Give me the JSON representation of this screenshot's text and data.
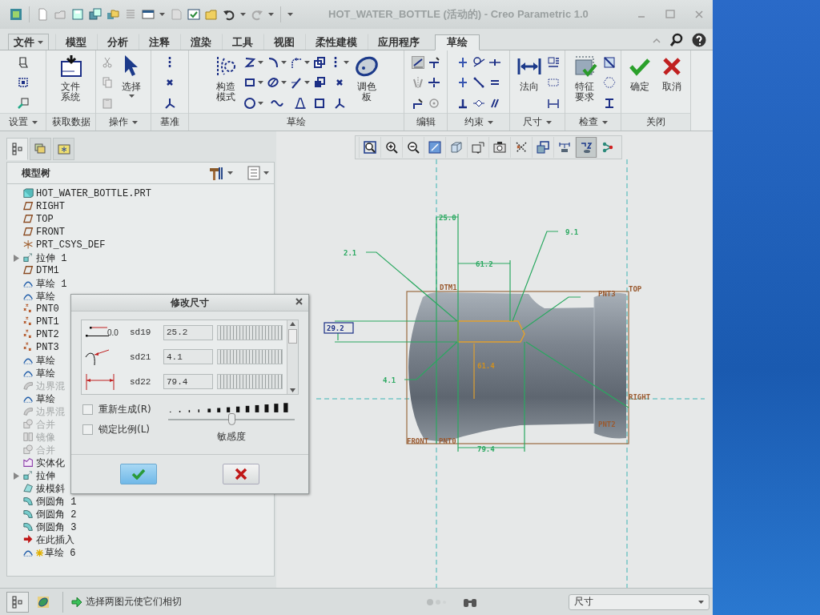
{
  "window": {
    "title": "HOT_WATER_BOTTLE (活动的) - Creo Parametric 1.0"
  },
  "ribbon_tabs": [
    {
      "label": "文件",
      "kind": "menu",
      "selected": false
    },
    {
      "label": "模型",
      "kind": "tab",
      "selected": false
    },
    {
      "label": "分析",
      "kind": "tab",
      "selected": false
    },
    {
      "label": "注释",
      "kind": "tab",
      "selected": false
    },
    {
      "label": "渲染",
      "kind": "tab",
      "selected": false
    },
    {
      "label": "工具",
      "kind": "tab",
      "selected": false
    },
    {
      "label": "视图",
      "kind": "tab",
      "selected": false
    },
    {
      "label": "柔性建模",
      "kind": "tab",
      "selected": false
    },
    {
      "label": "应用程序",
      "kind": "tab",
      "selected": false
    },
    {
      "label": "草绘",
      "kind": "tab",
      "selected": true
    }
  ],
  "ribbon_groups": [
    {
      "label": "设置",
      "dropdown": true
    },
    {
      "label": "获取数据",
      "buttons": [
        {
          "label": "文件系统"
        }
      ]
    },
    {
      "label": "操作",
      "dropdown": true,
      "buttons": [
        {
          "label": "选择"
        }
      ]
    },
    {
      "label": "基准"
    },
    {
      "label": "草绘",
      "buttons": [
        {
          "label": "构造模式"
        },
        {
          "label": "调色板"
        }
      ]
    },
    {
      "label": "编辑"
    },
    {
      "label": "约束",
      "dropdown": true
    },
    {
      "label": "尺寸",
      "dropdown": true,
      "buttons": [
        {
          "label": "法向"
        }
      ]
    },
    {
      "label": "检查",
      "dropdown": true,
      "buttons": [
        {
          "label": "特征要求"
        }
      ]
    },
    {
      "label": "关闭",
      "buttons": [
        {
          "label": "确定"
        },
        {
          "label": "取消"
        }
      ]
    }
  ],
  "model_tree": {
    "tabs": [
      {
        "selected": true
      },
      {
        "selected": false
      },
      {
        "selected": false
      }
    ],
    "title": "模型树",
    "items": [
      {
        "label": "HOT_WATER_BOTTLE.PRT",
        "kind": "part",
        "disabled": false,
        "expandable": false,
        "new": false,
        "children": [
          {
            "label": "RIGHT",
            "kind": "datum_plane",
            "disabled": false,
            "expandable": false,
            "new": false
          },
          {
            "label": "TOP",
            "kind": "datum_plane",
            "disabled": false,
            "expandable": false,
            "new": false
          },
          {
            "label": "FRONT",
            "kind": "datum_plane",
            "disabled": false,
            "expandable": false,
            "new": false
          },
          {
            "label": "PRT_CSYS_DEF",
            "kind": "csys",
            "disabled": false,
            "expandable": false,
            "new": false
          },
          {
            "label": "拉伸 1",
            "kind": "extrude",
            "disabled": false,
            "expandable": true,
            "new": false
          },
          {
            "label": "DTM1",
            "kind": "datum_plane",
            "disabled": false,
            "expandable": false,
            "new": false
          },
          {
            "label": "草绘 1",
            "kind": "sketch",
            "disabled": false,
            "expandable": false,
            "new": false
          },
          {
            "label": "草绘",
            "kind": "sketch",
            "disabled": false,
            "expandable": false,
            "new": false
          },
          {
            "label": "PNT0",
            "kind": "datum_point",
            "disabled": false,
            "expandable": false,
            "new": false
          },
          {
            "label": "PNT1",
            "kind": "datum_point",
            "disabled": false,
            "expandable": false,
            "new": false
          },
          {
            "label": "PNT2",
            "kind": "datum_point",
            "disabled": false,
            "expandable": false,
            "new": false
          },
          {
            "label": "PNT3",
            "kind": "datum_point",
            "disabled": false,
            "expandable": false,
            "new": false
          },
          {
            "label": "草绘",
            "kind": "sketch",
            "disabled": false,
            "expandable": false,
            "new": false
          },
          {
            "label": "草绘",
            "kind": "sketch",
            "disabled": false,
            "expandable": false,
            "new": false
          },
          {
            "label": "边界混",
            "kind": "blend",
            "disabled": true,
            "expandable": false,
            "new": false
          },
          {
            "label": "草绘",
            "kind": "sketch",
            "disabled": false,
            "expandable": false,
            "new": false
          },
          {
            "label": "边界混",
            "kind": "blend",
            "disabled": true,
            "expandable": false,
            "new": false
          },
          {
            "label": "合并",
            "kind": "merge",
            "disabled": true,
            "expandable": false,
            "new": false
          },
          {
            "label": "镜像",
            "kind": "mirror",
            "disabled": true,
            "expandable": false,
            "new": false
          },
          {
            "label": "合并",
            "kind": "merge",
            "disabled": true,
            "expandable": false,
            "new": false
          },
          {
            "label": "实体化",
            "kind": "solidify",
            "disabled": false,
            "expandable": false,
            "new": false
          },
          {
            "label": "拉伸",
            "kind": "extrude",
            "disabled": false,
            "expandable": true,
            "new": false
          },
          {
            "label": "拔模斜",
            "kind": "draft",
            "disabled": false,
            "expandable": false,
            "new": false
          },
          {
            "label": "倒圆角 1",
            "kind": "round",
            "disabled": false,
            "expandable": false,
            "new": false
          },
          {
            "label": "倒圆角 2",
            "kind": "round",
            "disabled": false,
            "expandable": false,
            "new": false
          },
          {
            "label": "倒圆角 3",
            "kind": "round",
            "disabled": false,
            "expandable": false,
            "new": false
          },
          {
            "label": "在此插入",
            "kind": "insert",
            "disabled": false,
            "expandable": false,
            "new": false
          },
          {
            "label": "草绘 6",
            "kind": "sketch",
            "disabled": false,
            "expandable": false,
            "new": true
          }
        ]
      }
    ]
  },
  "view_toolbar": [
    {
      "selected": false
    },
    {
      "selected": false
    },
    {
      "selected": false
    },
    {
      "selected": false
    },
    {
      "selected": false
    },
    {
      "selected": false
    },
    {
      "selected": false
    },
    {
      "selected": false
    },
    {
      "selected": false
    },
    {
      "selected": false
    },
    {
      "selected": true
    },
    {
      "selected": false
    }
  ],
  "sketch": {
    "labels": [
      {
        "text": "25.0",
        "kind": "dimension"
      },
      {
        "text": "2.1",
        "kind": "dimension"
      },
      {
        "text": "9.1",
        "kind": "dimension"
      },
      {
        "text": "61.2",
        "kind": "dimension"
      },
      {
        "text": "DTM1",
        "kind": "datum"
      },
      {
        "text": "PNT3",
        "kind": "datum"
      },
      {
        "text": "TOP",
        "kind": "datum"
      },
      {
        "text": "29.2",
        "kind": "selected"
      },
      {
        "text": "61.4",
        "kind": "highlighted"
      },
      {
        "text": "4.1",
        "kind": "dimension"
      },
      {
        "text": "RIGHT",
        "kind": "datum"
      },
      {
        "text": "PNT2",
        "kind": "datum"
      },
      {
        "text": "FRONT",
        "kind": "datum"
      },
      {
        "text": "PNT0",
        "kind": "datum"
      },
      {
        "text": "79.4",
        "kind": "dimension"
      }
    ]
  },
  "dialog": {
    "title": "修改尺寸",
    "rows": [
      {
        "kind": "linear",
        "icon_label": "0.0",
        "name": "sd19",
        "value": "25.2"
      },
      {
        "kind": "radius",
        "name": "sd21",
        "value": "4.1"
      },
      {
        "kind": "distance",
        "name": "sd22",
        "value": "79.4"
      }
    ],
    "options": [
      {
        "label": "重新生成(R)",
        "checked": false
      },
      {
        "label": "锁定比例(L)",
        "checked": false
      }
    ],
    "sensitivity": {
      "label": "敏感度",
      "level": 0.5
    }
  },
  "status_bar": {
    "tree_buttons": [
      {
        "selected": true
      },
      {
        "selected": false
      }
    ],
    "message": "选择两图元使它们相切",
    "filter": "尺寸"
  }
}
